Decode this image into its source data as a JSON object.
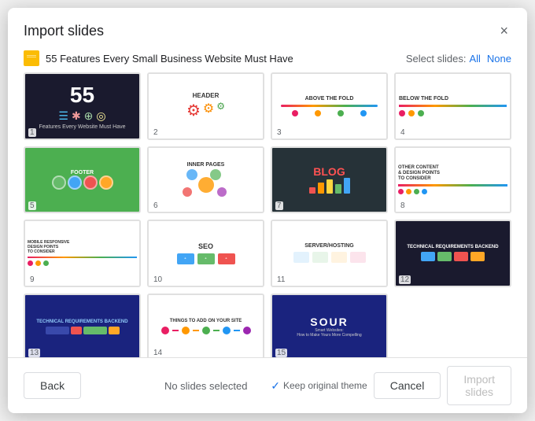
{
  "dialog": {
    "title": "Import slides",
    "close_label": "×",
    "presentation_icon": "▣",
    "presentation_title": "55 Features Every Small Business Website Must Have",
    "select_slides_label": "Select slides:",
    "all_label": "All",
    "none_label": "None"
  },
  "slides": [
    {
      "number": "1",
      "label": "slide-1"
    },
    {
      "number": "2",
      "label": "slide-2"
    },
    {
      "number": "3",
      "label": "slide-3"
    },
    {
      "number": "4",
      "label": "slide-4"
    },
    {
      "number": "5",
      "label": "slide-5"
    },
    {
      "number": "6",
      "label": "slide-6"
    },
    {
      "number": "7",
      "label": "slide-7"
    },
    {
      "number": "8",
      "label": "slide-8"
    },
    {
      "number": "9",
      "label": "slide-9"
    },
    {
      "number": "10",
      "label": "slide-10"
    },
    {
      "number": "11",
      "label": "slide-11"
    },
    {
      "number": "12",
      "label": "slide-12"
    },
    {
      "number": "13",
      "label": "slide-13"
    },
    {
      "number": "14",
      "label": "slide-14"
    },
    {
      "number": "15",
      "label": "slide-15"
    }
  ],
  "footer": {
    "back_label": "Back",
    "status_label": "No slides selected",
    "cancel_label": "Cancel",
    "import_label": "Import slides",
    "keep_theme_label": "Keep original theme"
  }
}
